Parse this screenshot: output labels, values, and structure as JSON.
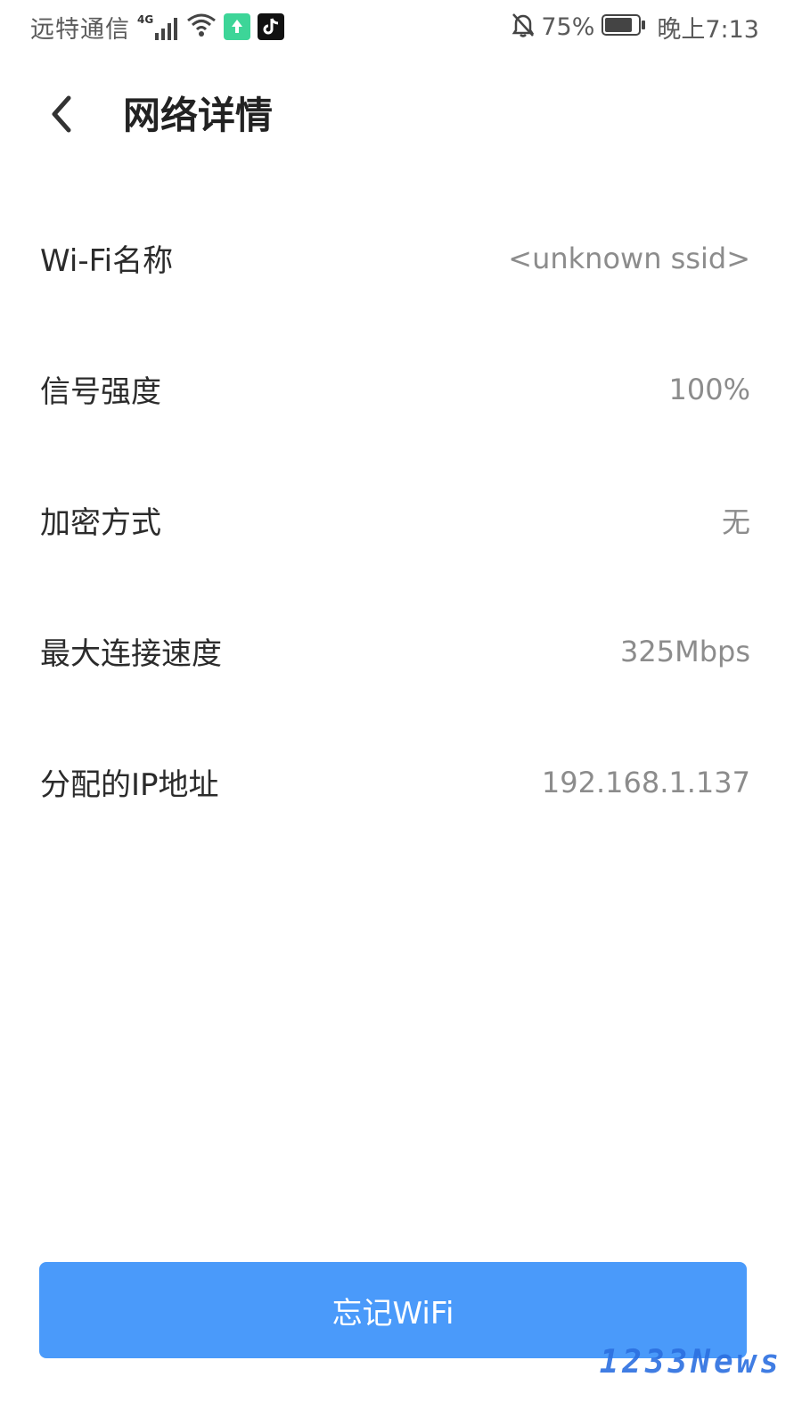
{
  "status_bar": {
    "carrier": "远特通信",
    "network_type": "4G",
    "battery_percent": "75%",
    "time": "晚上7:13",
    "icons": [
      "signal-icon",
      "wifi-icon",
      "app-green-icon",
      "tiktok-icon",
      "silent-bell-icon",
      "battery-icon"
    ]
  },
  "header": {
    "title": "网络详情",
    "back_icon": "chevron-left-icon"
  },
  "details": [
    {
      "label": "Wi-Fi名称",
      "value": "<unknown ssid>"
    },
    {
      "label": "信号强度",
      "value": "100%"
    },
    {
      "label": "加密方式",
      "value": "无"
    },
    {
      "label": "最大连接速度",
      "value": "325Mbps"
    },
    {
      "label": "分配的IP地址",
      "value": "192.168.1.137"
    }
  ],
  "forget_button": {
    "label": "忘记WiFi"
  },
  "watermark": "1233News",
  "colors": {
    "accent": "#4a9afa",
    "label_text": "#2b2b2b",
    "value_text": "#8c8c8c",
    "watermark": "#2c6fe0"
  }
}
